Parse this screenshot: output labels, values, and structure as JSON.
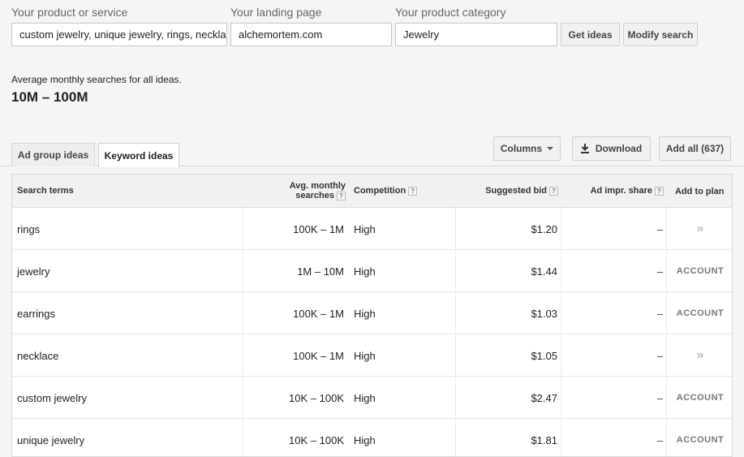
{
  "form": {
    "product_label": "Your product or service",
    "product_value": "custom jewelry, unique jewelry, rings, necklaces",
    "landing_label": "Your landing page",
    "landing_value": "alchemortem.com",
    "category_label": "Your product category",
    "category_value": "Jewelry",
    "get_ideas_label": "Get ideas",
    "modify_search_label": "Modify search"
  },
  "summary": {
    "label": "Average monthly searches for all ideas.",
    "value": "10M – 100M"
  },
  "tabs": [
    {
      "label": "Ad group ideas",
      "active": false
    },
    {
      "label": "Keyword ideas",
      "active": true
    }
  ],
  "toolbar": {
    "columns_label": "Columns",
    "download_label": "Download",
    "add_all_label": "Add all (637)"
  },
  "table": {
    "headers": {
      "search_terms": "Search terms",
      "avg_monthly_1": "Avg. monthly",
      "avg_monthly_2": "searches",
      "competition": "Competition",
      "suggested_bid": "Suggested bid",
      "ad_impr_share": "Ad impr. share",
      "add_to_plan": "Add to plan",
      "help_glyph": "?"
    },
    "rows": [
      {
        "term": "rings",
        "searches": "100K – 1M",
        "competition": "High",
        "bid": "$1.20",
        "impr": "–",
        "plan": "»",
        "plan_type": "chevron"
      },
      {
        "term": "jewelry",
        "searches": "1M – 10M",
        "competition": "High",
        "bid": "$1.44",
        "impr": "–",
        "plan": "ACCOUNT",
        "plan_type": "account"
      },
      {
        "term": "earrings",
        "searches": "100K – 1M",
        "competition": "High",
        "bid": "$1.03",
        "impr": "–",
        "plan": "ACCOUNT",
        "plan_type": "account"
      },
      {
        "term": "necklace",
        "searches": "100K – 1M",
        "competition": "High",
        "bid": "$1.05",
        "impr": "–",
        "plan": "»",
        "plan_type": "chevron"
      },
      {
        "term": "custom jewelry",
        "searches": "10K – 100K",
        "competition": "High",
        "bid": "$2.47",
        "impr": "–",
        "plan": "ACCOUNT",
        "plan_type": "account"
      },
      {
        "term": "unique jewelry",
        "searches": "10K – 100K",
        "competition": "High",
        "bid": "$1.81",
        "impr": "–",
        "plan": "ACCOUNT",
        "plan_type": "account"
      }
    ]
  },
  "colors": {
    "background": "#f5f5f5",
    "table_header": "#f1f1f1",
    "button": "#f1f1f1"
  }
}
